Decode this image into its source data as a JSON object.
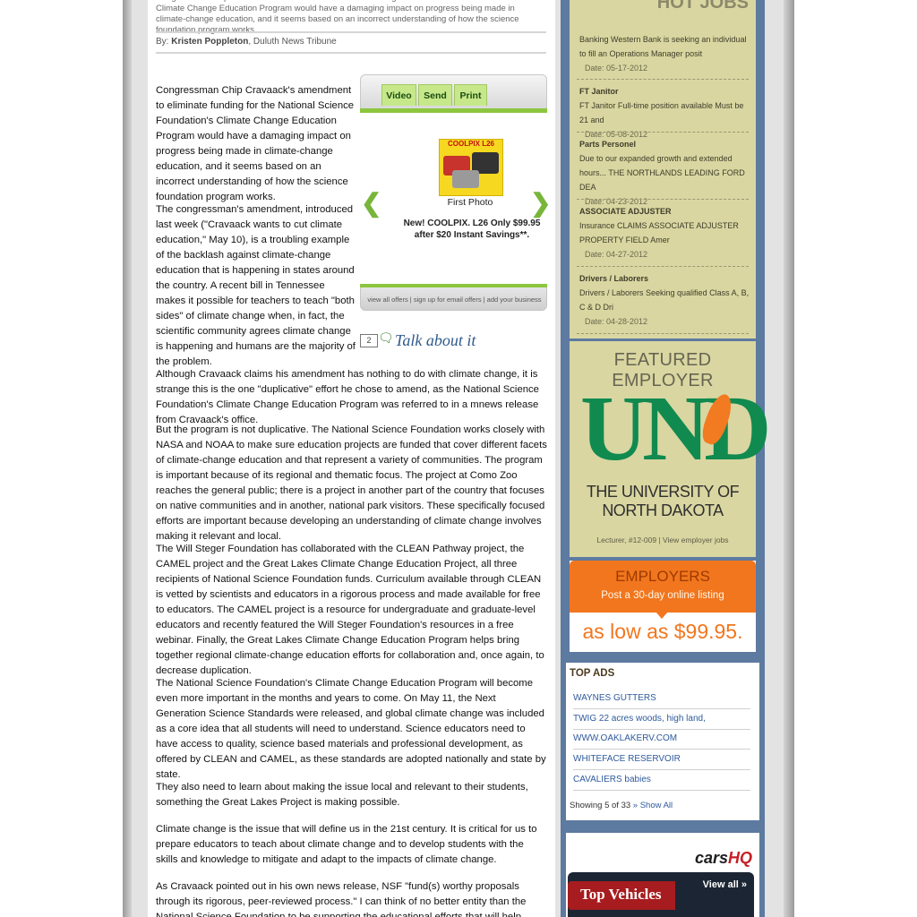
{
  "article": {
    "summary": "Congressman Chip Cravaack's amendment to eliminate funding for the National Science Foundation's Climate Change Education Program would have a damaging impact on progress being made in climate-change education, and it seems based on an incorrect understanding of how the science foundation program works.",
    "byline_prefix": "By:",
    "author": "Kristen Poppleton",
    "publication": ", Duluth News Tribune",
    "paragraphs": [
      "Congressman Chip Cravaack's amendment to eliminate funding for the National Science Foundation's Climate Change Education Program would have a damaging impact on progress being made in climate-change education, and it seems based on an incorrect understanding of how the science foundation program works.",
      "The congressman's amendment, introduced last week (\"Cravaack wants to cut climate education,\" May 10), is a troubling example of the backlash against climate-change education that is happening in states around the country. A recent bill in Tennessee makes it possible for teachers to teach \"both sides\" of climate change when, in fact, the scientific community agrees climate change is happening and humans are the majority of the problem.",
      "Although Cravaack claims his amendment has nothing to do with climate change, it is strange this is the one \"duplicative\" effort he chose to amend, as the National Science Foundation's Climate Change Education Program was referred to in a mnews release from Cravaack's office.",
      "But the program is not duplicative. The National Science Foundation works closely with NASA and NOAA to make sure education projects are funded that cover different facets of climate-change education and that represent a variety of communities. The program is important because of its regional and thematic focus. The project at Como Zoo reaches the general public; there is a project in another part of the country that focuses on native communities and in another, national park visitors. These specifically focused efforts are important because developing an understanding of climate change involves making it relevant and local.",
      "The Will Steger Foundation has collaborated with the CLEAN Pathway project, the CAMEL project and the Great Lakes Climate Change Education Project, all three recipients of National Science Foundation funds. Curriculum available through CLEAN is vetted by scientists and educators in a rigorous process and made available for free to educators. The CAMEL project is a resource for undergraduate and graduate-level educators and recently featured the Will Steger Foundation's resources in a free webinar. Finally, the Great Lakes Climate Change Education Program helps bring together regional climate-change education efforts for collaboration and, once again, to decrease duplication.",
      "The National Science Foundation's Climate Change Education Program will become even more important in the months and years to come. On May 11, the Next Generation Science Standards were released, and global climate change was included as a core idea that all students will need to understand. Science educators need to have access to quality, science based materials and professional development, as offered by CLEAN and CAMEL, as these standards are adopted nationally and state by state.",
      "They also need to learn about making the issue local and relevant to their students, something the Great Lakes Project is making possible.",
      "Climate change is the issue that will define us in the 21st century. It is critical for us to prepare educators to teach about climate change and to develop students with the skills and knowledge to mitigate and adapt to the impacts of climate change.",
      "As Cravaack pointed out in his own news release, NSF \"fund(s) worthy proposals through its rigorous, peer-reviewed process.\" I can think of no better entity than the National Science Foundation to be supporting the educational efforts that will help define our future."
    ]
  },
  "media": {
    "tabs": [
      "Video",
      "Send",
      "Print"
    ],
    "ad_brand": "COOLPIX L26",
    "caption": "First Photo",
    "offer": "New! COOLPIX. L26 Only $99.95 after $20 Instant Savings**.",
    "footer_links": "view all offers | sign up for email offers | add your business",
    "talk_count": "2",
    "talk_label": "Talk about it"
  },
  "sidebar": {
    "jobs_title": "HOT JOBS",
    "jobs": [
      {
        "title": "",
        "desc": "Banking Western Bank is seeking an individual to fill an Operations Manager posit",
        "date": "Date: 05-17-2012"
      },
      {
        "title": "FT Janitor",
        "desc": "FT Janitor Full-time position available Must be 21 and",
        "date": "Date: 05-08-2012"
      },
      {
        "title": "Parts Personel",
        "desc": "Due to our expanded growth and extended hours... THE NORTHLANDS LEADING FORD DEA",
        "date": "Date: 04-23-2012"
      },
      {
        "title": "ASSOCIATE ADJUSTER",
        "desc": "Insurance CLAIMS ASSOCIATE ADJUSTER PROPERTY FIELD Amer",
        "date": "Date: 04-27-2012"
      },
      {
        "title": "Drivers / Laborers",
        "desc": "Drivers / Laborers Seeking qualified Class A, B, C & D Dri",
        "date": "Date: 04-28-2012"
      }
    ],
    "featured_title": "FEATURED EMPLOYER",
    "employer_logo": "UND",
    "employer_name_1": "THE UNIVERSITY OF",
    "employer_name_2": "NORTH DAKOTA",
    "employer_links": "Lecturer, #12-009 | View employer jobs",
    "employers_head": "EMPLOYERS",
    "employers_sub": "Post a 30-day online listing",
    "employers_price": "as low as $99.95.",
    "top_ads_title": "TOP ADS",
    "top_ads": [
      "WAYNES GUTTERS",
      "TWIG 22 acres woods, high land,",
      "WWW.OAKLAKERV.COM",
      "WHITEFACE RESERVOIR",
      "CAVALIERS babies"
    ],
    "ads_showing": "Showing 5 of 33",
    "ads_show_all": "» Show All",
    "cars_logo_1": "cars",
    "cars_logo_2": "HQ",
    "top_vehicles": "Top Vehicles",
    "view_all": "View all »"
  },
  "colors": {
    "accent_green": "#8cc63f",
    "sidebar_blue": "#5d7aa0",
    "jobs_bg": "#d9d6a1",
    "employer_orange": "#f2761e",
    "und_green": "#118a50"
  }
}
